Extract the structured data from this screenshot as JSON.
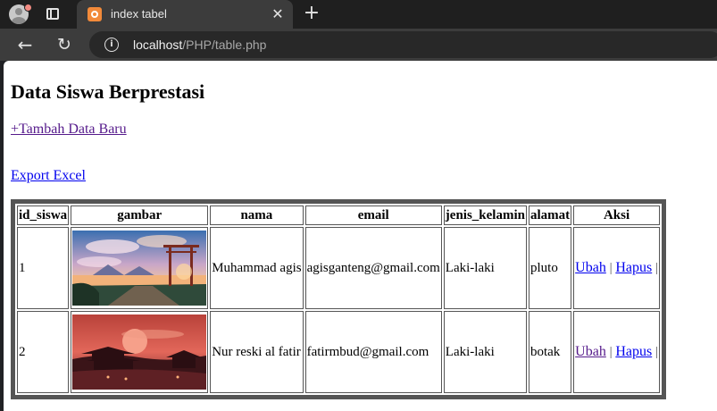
{
  "browser": {
    "tab_title": "index tabel",
    "url_host": "localhost",
    "url_path": "/PHP/table.php",
    "close_glyph": "✕",
    "new_tab_glyph": "+",
    "back_glyph": "←",
    "reload_glyph": "↻",
    "info_glyph": "i"
  },
  "page": {
    "heading": "Data Siswa Berprestasi",
    "add_link": "+Tambah Data Baru",
    "export_link": "Export Excel"
  },
  "table": {
    "headers": [
      "id_siswa",
      "gambar",
      "nama",
      "email",
      "jenis_kelamin",
      "alamat",
      "Aksi"
    ],
    "rows": [
      {
        "id": "1",
        "image": "torii-gate-lake-landscape",
        "nama": "Muhammad agis",
        "email": "agisganteng@gmail.com",
        "jenis_kelamin": "Laki-laki",
        "alamat": "pluto",
        "edit": "Ubah",
        "delete": "Hapus",
        "separator": "|"
      },
      {
        "id": "2",
        "image": "red-sunset-pagoda-landscape",
        "nama": "Nur reski al fatir",
        "email": "fatirmbud@gmail.com",
        "jenis_kelamin": "Laki-laki",
        "alamat": "botak",
        "edit": "Ubah",
        "delete": "Hapus",
        "separator": "|"
      }
    ]
  },
  "colors": {
    "link": "#0000ee",
    "visited_link": "#551a8b",
    "table_border": "#555555",
    "chrome_dark": "#1f1f1f",
    "chrome_toolbar": "#3c3c3c"
  }
}
